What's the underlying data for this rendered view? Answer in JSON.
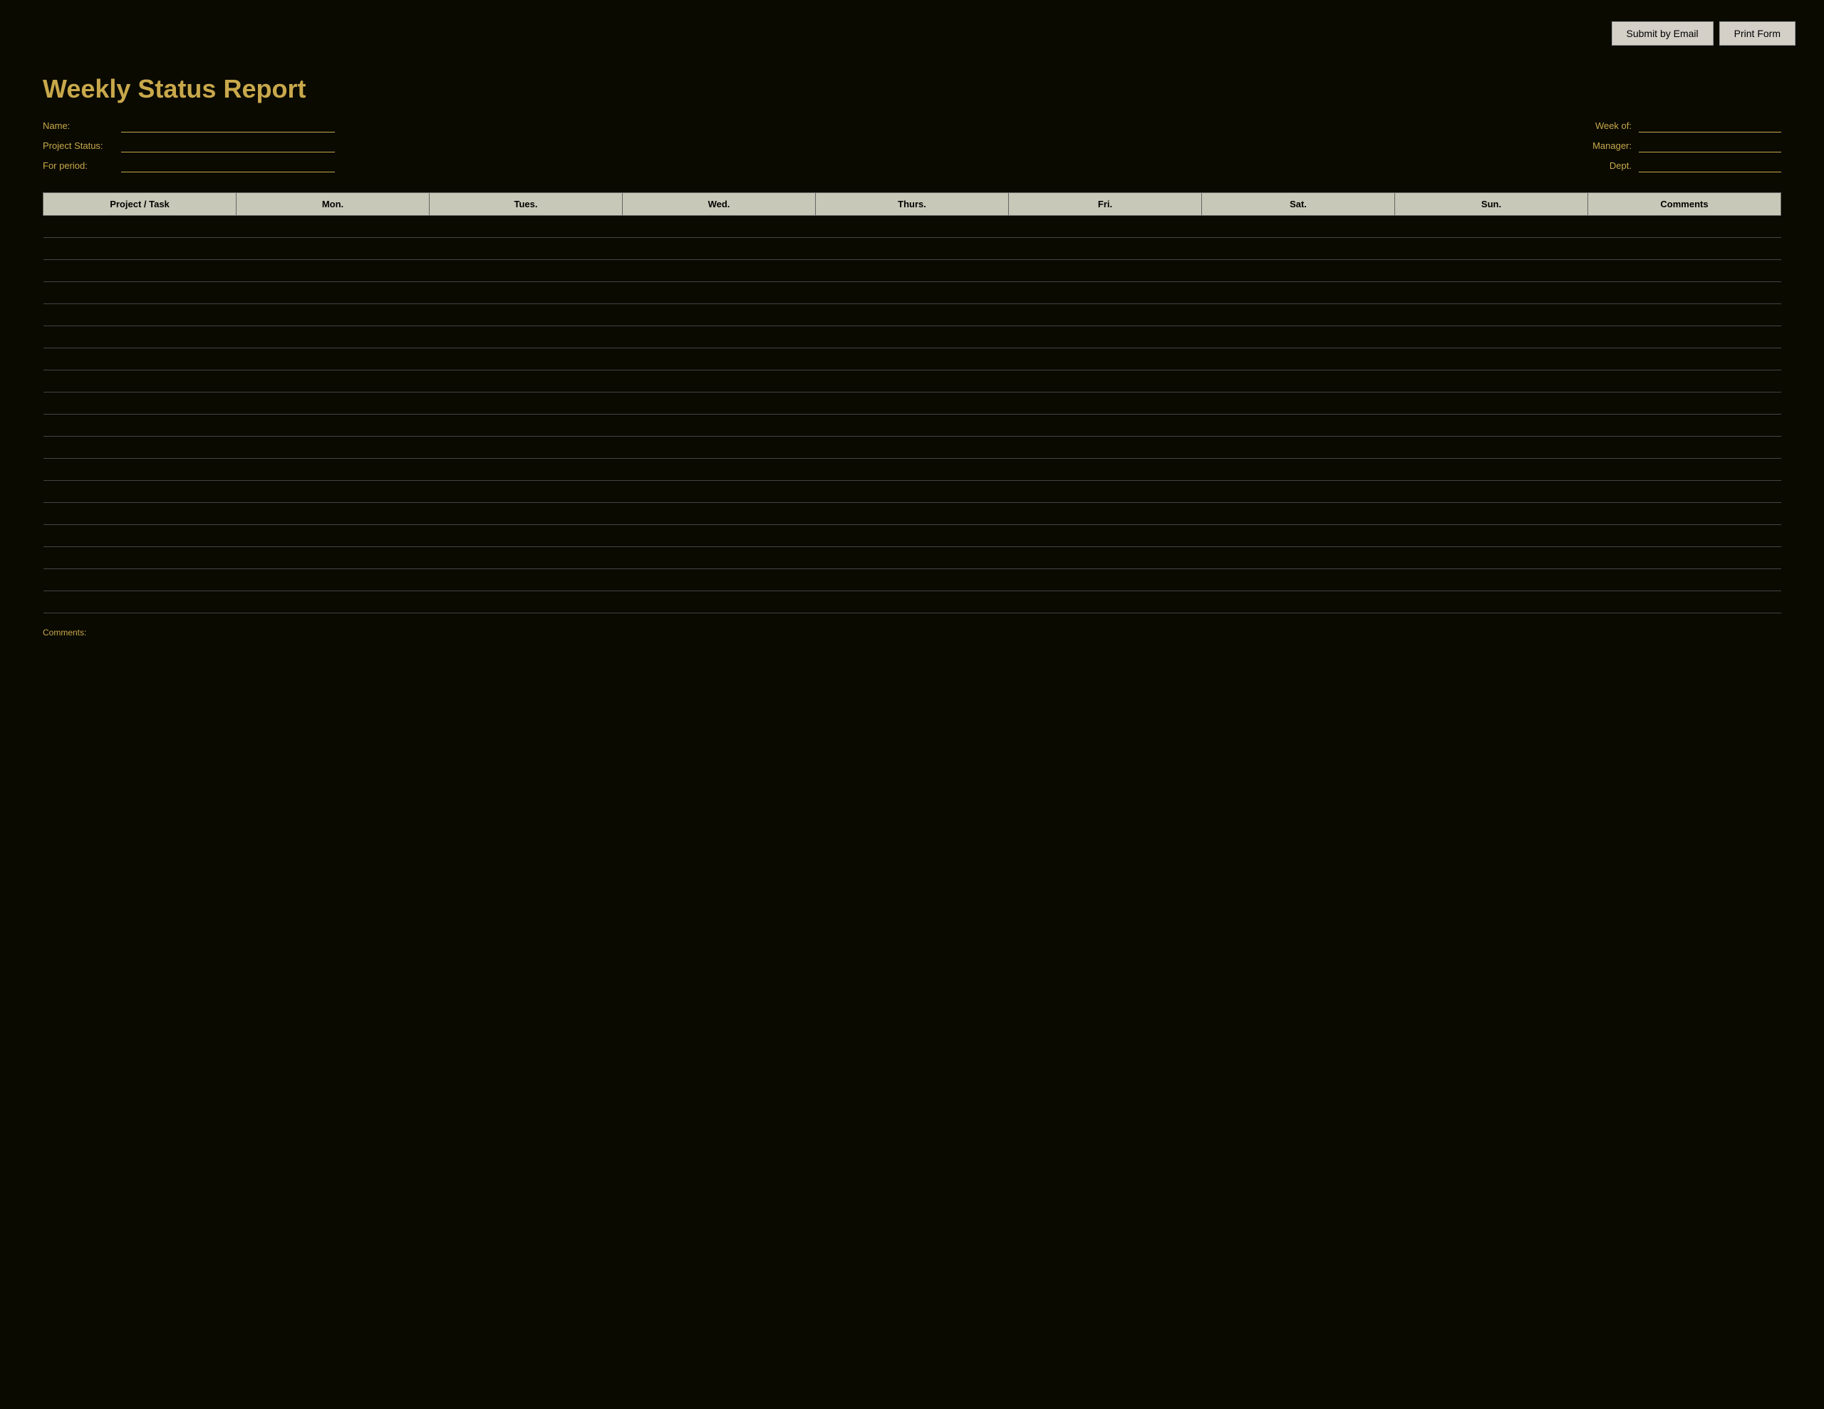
{
  "toolbar": {
    "submit_email_label": "Submit by Email",
    "print_form_label": "Print Form"
  },
  "header": {
    "title": "Weekly Status Report"
  },
  "form": {
    "name_label": "Name:",
    "name_value": "",
    "project_status_label": "Project Status:",
    "project_status_value": "",
    "for_period_label": "For period:",
    "for_period_value": "",
    "week_of_label": "Week of:",
    "week_of_value": "",
    "manager_label": "Manager:",
    "manager_value": "",
    "dept_label": "Dept.",
    "dept_value": ""
  },
  "table": {
    "columns": [
      "Project / Task",
      "Mon.",
      "Tues.",
      "Wed.",
      "Thurs.",
      "Fri.",
      "Sat.",
      "Sun.",
      "Comments"
    ],
    "row_count": 18
  },
  "footer": {
    "comments_label": "Comments:"
  }
}
